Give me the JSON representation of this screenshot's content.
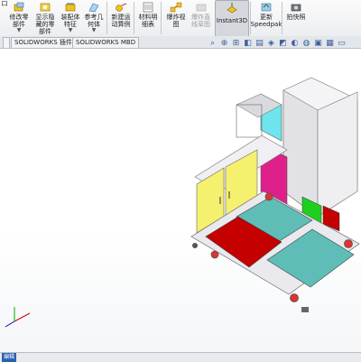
{
  "ribbon": {
    "buttons": [
      {
        "label": "口",
        "icon": "partial-icon"
      },
      {
        "label": "修改零\n部件",
        "icon": "modify-part-icon"
      },
      {
        "label": "显示隐\n藏的零\n部件",
        "icon": "show-hidden-icon"
      },
      {
        "label": "装配体\n特征",
        "icon": "assembly-feature-icon"
      },
      {
        "label": "参考几\n何体",
        "icon": "reference-geometry-icon"
      },
      {
        "label": "新建运\n动算例",
        "icon": "motion-study-icon"
      },
      {
        "label": "材料明\n细表",
        "icon": "bom-icon"
      },
      {
        "label": "爆炸视\n图",
        "icon": "exploded-view-icon"
      },
      {
        "label": "爆炸直\n线草图",
        "icon": "explode-line-sketch-icon",
        "disabled": true
      },
      {
        "label": "Instant3D",
        "icon": "instant3d-icon",
        "active": true
      },
      {
        "label": "更新\nSpeedpak",
        "icon": "speedpak-icon"
      },
      {
        "label": "拍快照",
        "icon": "snapshot-icon"
      }
    ]
  },
  "tabs": [
    "SOLIDWORKS 插件",
    "SOLIDWORKS MBD"
  ],
  "view_toolbar": [
    "search-icon",
    "zoom-fit-icon",
    "zoom-area-icon",
    "previous-view-icon",
    "section-view-icon",
    "view-orientation-icon",
    "display-style-icon",
    "hide-show-icon",
    "edit-appearance-icon",
    "scene-icon",
    "view-settings-icon",
    "screen-capture-icon"
  ],
  "status": {
    "text": "编辑"
  },
  "colors": {
    "yellow": "#f5f06e",
    "magenta": "#e0208a",
    "teal": "#5fbdb7",
    "red": "#c40000",
    "green": "#1ecf1e",
    "cyan": "#6fe4ec",
    "frame": "#e9e9ee"
  }
}
